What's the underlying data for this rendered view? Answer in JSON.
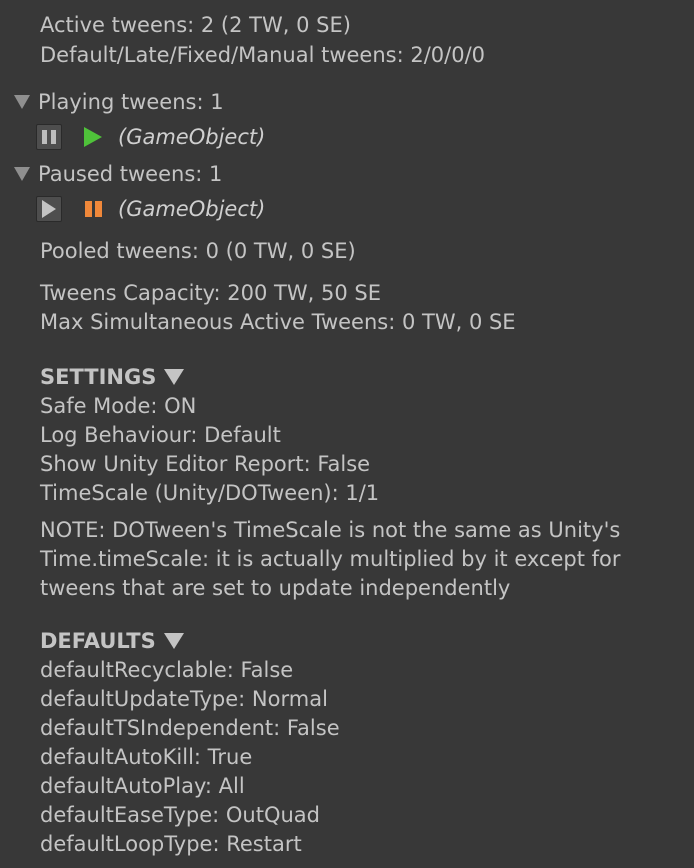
{
  "stats": {
    "active_tweens": "Active tweens: 2 (2 TW, 0 SE)",
    "default_late_fixed_manual": "Default/Late/Fixed/Manual tweens: 2/0/0/0"
  },
  "playing": {
    "header": "Playing tweens: 1",
    "items": [
      {
        "target": "(GameObject)",
        "state": "playing",
        "toggle_icon": "pause-icon",
        "state_icon": "play-icon",
        "state_color": "#4fc23a"
      }
    ]
  },
  "paused": {
    "header": "Paused tweens: 1",
    "items": [
      {
        "target": "(GameObject)",
        "state": "paused",
        "toggle_icon": "play-icon",
        "state_icon": "pause-icon",
        "state_color": "#f0883a"
      }
    ]
  },
  "pool": {
    "pooled": "Pooled tweens: 0 (0 TW, 0 SE)",
    "capacity": "Tweens Capacity: 200 TW, 50 SE",
    "max_active": "Max Simultaneous Active Tweens: 0 TW, 0 SE"
  },
  "settings": {
    "title": "SETTINGS",
    "safe_mode": "Safe Mode: ON",
    "log_behaviour": "Log Behaviour: Default",
    "editor_report": "Show Unity Editor Report: False",
    "timescale": "TimeScale (Unity/DOTween): 1/1",
    "note_line1": "NOTE: DOTween's TimeScale is not the same as Unity's",
    "note_line2": "Time.timeScale: it is actually multiplied by it except for",
    "note_line3": "tweens that are set to update independently"
  },
  "defaults": {
    "title": "DEFAULTS",
    "items": [
      "defaultRecyclable: False",
      "defaultUpdateType: Normal",
      "defaultTSIndependent: False",
      "defaultAutoKill: True",
      "defaultAutoPlay: All",
      "defaultEaseType: OutQuad",
      "defaultLoopType: Restart"
    ]
  }
}
